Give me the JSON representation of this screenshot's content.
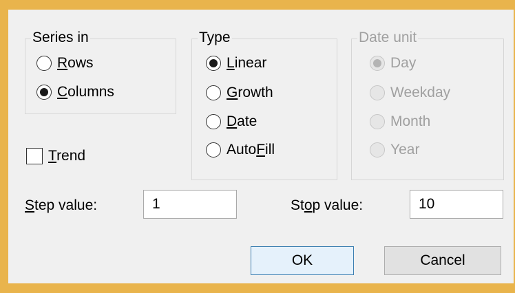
{
  "series_in": {
    "title": "Series in",
    "options": [
      {
        "pre": "",
        "key": "R",
        "post": "ows",
        "selected": false
      },
      {
        "pre": "",
        "key": "C",
        "post": "olumns",
        "selected": true
      }
    ]
  },
  "type": {
    "title": "Type",
    "options": [
      {
        "pre": "",
        "key": "L",
        "post": "inear",
        "selected": true
      },
      {
        "pre": "",
        "key": "G",
        "post": "rowth",
        "selected": false
      },
      {
        "pre": "",
        "key": "D",
        "post": "ate",
        "selected": false
      },
      {
        "pre": "Auto",
        "key": "F",
        "post": "ill",
        "selected": false
      }
    ]
  },
  "date_unit": {
    "title": "Date unit",
    "disabled": true,
    "options": [
      {
        "label": "Day",
        "selected": true
      },
      {
        "label": "Weekday",
        "selected": false
      },
      {
        "label": "Month",
        "selected": false
      },
      {
        "label": "Year",
        "selected": false
      }
    ]
  },
  "trend": {
    "pre": "",
    "key": "T",
    "post": "rend",
    "checked": false
  },
  "step": {
    "pre": "",
    "key": "S",
    "post": "tep value:",
    "value": "1"
  },
  "stop": {
    "pre": "St",
    "key": "o",
    "post": "p value:",
    "value": "10"
  },
  "buttons": {
    "ok": "OK",
    "cancel": "Cancel"
  }
}
